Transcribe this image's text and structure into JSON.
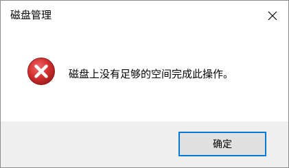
{
  "window": {
    "title": "磁盘管理",
    "close_icon": "close-icon"
  },
  "dialog": {
    "icon": "error-icon",
    "message": "磁盘上没有足够的空间完成此操作。"
  },
  "buttons": {
    "ok_label": "确定"
  },
  "colors": {
    "accent": "#0078d7",
    "error_red": "#d32f2f",
    "footer_bg": "#f0f0f0"
  }
}
